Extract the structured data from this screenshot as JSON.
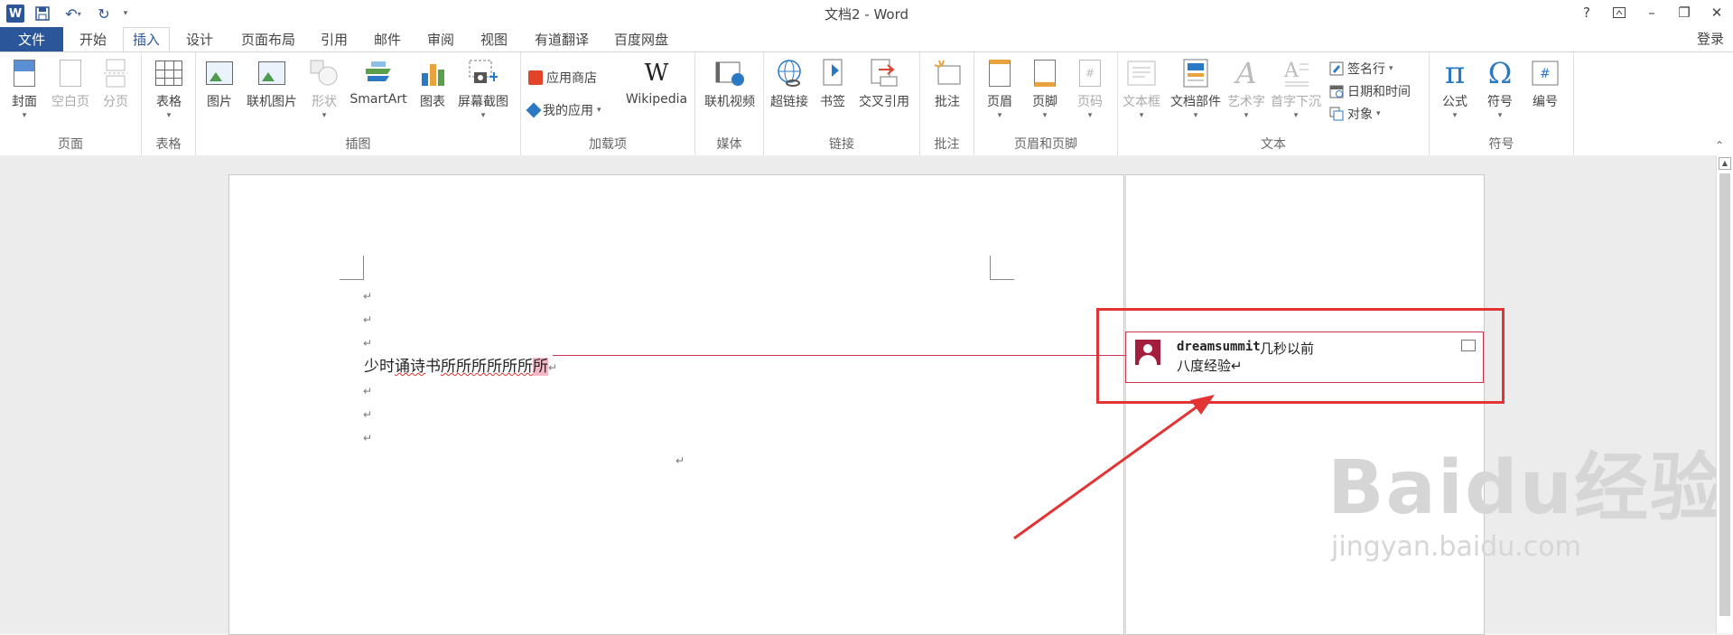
{
  "window": {
    "title": "文档2 - Word",
    "help": "?",
    "login": "登录"
  },
  "tabs": [
    "文件",
    "开始",
    "插入",
    "设计",
    "页面布局",
    "引用",
    "邮件",
    "审阅",
    "视图",
    "有道翻译",
    "百度网盘"
  ],
  "ribbon": {
    "groups": {
      "pages": "页面",
      "tables": "表格",
      "illustrations": "插图",
      "addins": "加载项",
      "media": "媒体",
      "links": "链接",
      "comments": "批注",
      "header_footer": "页眉和页脚",
      "text": "文本",
      "symbols": "符号"
    },
    "buttons": {
      "cover": "封面",
      "blank_page": "空白页",
      "page_break": "分页",
      "table": "表格",
      "pictures": "图片",
      "online_pictures": "联机图片",
      "shapes": "形状",
      "smartart": "SmartArt",
      "chart": "图表",
      "screenshot": "屏幕截图",
      "store": "应用商店",
      "my_apps": "我的应用",
      "wikipedia": "Wikipedia",
      "online_video": "联机视频",
      "hyperlink": "超链接",
      "bookmark": "书签",
      "cross_ref": "交叉引用",
      "comment": "批注",
      "header": "页眉",
      "footer": "页脚",
      "page_number": "页码",
      "textbox": "文本框",
      "quick_parts": "文档部件",
      "wordart": "艺术字",
      "dropcap": "首字下沉",
      "signature": "签名行",
      "datetime": "日期和时间",
      "object": "对象",
      "equation": "公式",
      "symbol": "符号",
      "number": "编号"
    }
  },
  "document": {
    "paragraph_mark": "↵",
    "body_normal": "少时",
    "body_squiggle1": "诵诗",
    "body_mid": "书",
    "body_squiggle2": "所所所所所所",
    "body_highlight": "所"
  },
  "comment": {
    "author": "dreamsummit",
    "time": "几秒以前",
    "text": "八度经验↵"
  },
  "watermark": {
    "logo": "Baidu经验",
    "url": "jingyan.baidu.com"
  },
  "colors": {
    "word_blue": "#2b579a",
    "comment_red": "#c9334d",
    "annotation_red": "#e23434"
  }
}
